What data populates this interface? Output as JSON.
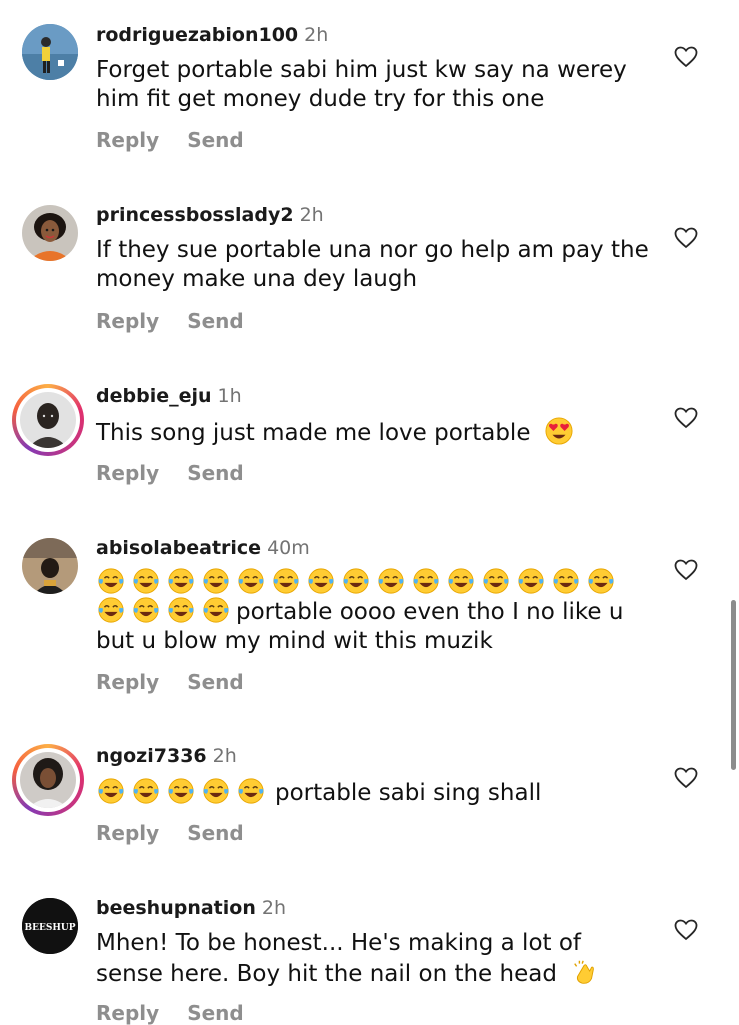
{
  "colors": {
    "username": "#1a1a1a",
    "meta": "#737373",
    "action": "#8e8e8e",
    "story_ring": "#e1306c"
  },
  "comments": [
    {
      "username": "rodriguezabion100",
      "time": "2h",
      "text": "Forget portable sabi him just kw say na werey him fit get money dude try for this one",
      "reply": "Reply",
      "send": "Send"
    },
    {
      "username": "princessbosslady2",
      "time": "2h",
      "text": "If they sue portable una nor go help am pay the money make una dey laugh",
      "reply": "Reply",
      "send": "Send"
    },
    {
      "username": "debbie_eju",
      "time": "1h",
      "text": "This song just made me love portable",
      "emoji": "heart-eyes",
      "reply": "Reply",
      "send": "Send"
    },
    {
      "username": "abisolabeatrice",
      "time": "40m",
      "text_after": "portable oooo even tho I no like u",
      "text_line3": "but u blow my mind wit this muzik",
      "emoji": "tears-of-joy",
      "emoji_count": 19,
      "reply": "Reply",
      "send": "Send"
    },
    {
      "username": "ngozi7336",
      "time": "2h",
      "text": "portable sabi sing shall",
      "emoji": "tears-of-joy",
      "emoji_count": 5,
      "reply": "Reply",
      "send": "Send"
    },
    {
      "username": "beeshupnation",
      "time": "2h",
      "avatar_text": "BEESHUP",
      "text": "Mhen! To be honest... He's making a lot of sense here. Boy hit the nail on the head",
      "emoji": "clapping-hands",
      "reply": "Reply",
      "send": "Send"
    }
  ]
}
